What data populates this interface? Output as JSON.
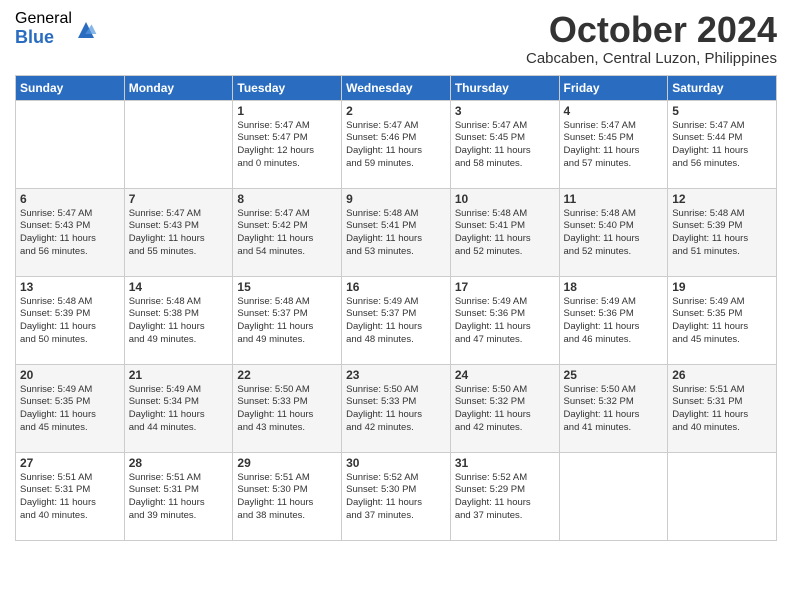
{
  "header": {
    "logo_general": "General",
    "logo_blue": "Blue",
    "month_title": "October 2024",
    "location": "Cabcaben, Central Luzon, Philippines"
  },
  "days_of_week": [
    "Sunday",
    "Monday",
    "Tuesday",
    "Wednesday",
    "Thursday",
    "Friday",
    "Saturday"
  ],
  "weeks": [
    [
      {
        "day": "",
        "content": ""
      },
      {
        "day": "",
        "content": ""
      },
      {
        "day": "1",
        "content": "Sunrise: 5:47 AM\nSunset: 5:47 PM\nDaylight: 12 hours\nand 0 minutes."
      },
      {
        "day": "2",
        "content": "Sunrise: 5:47 AM\nSunset: 5:46 PM\nDaylight: 11 hours\nand 59 minutes."
      },
      {
        "day": "3",
        "content": "Sunrise: 5:47 AM\nSunset: 5:45 PM\nDaylight: 11 hours\nand 58 minutes."
      },
      {
        "day": "4",
        "content": "Sunrise: 5:47 AM\nSunset: 5:45 PM\nDaylight: 11 hours\nand 57 minutes."
      },
      {
        "day": "5",
        "content": "Sunrise: 5:47 AM\nSunset: 5:44 PM\nDaylight: 11 hours\nand 56 minutes."
      }
    ],
    [
      {
        "day": "6",
        "content": "Sunrise: 5:47 AM\nSunset: 5:43 PM\nDaylight: 11 hours\nand 56 minutes."
      },
      {
        "day": "7",
        "content": "Sunrise: 5:47 AM\nSunset: 5:43 PM\nDaylight: 11 hours\nand 55 minutes."
      },
      {
        "day": "8",
        "content": "Sunrise: 5:47 AM\nSunset: 5:42 PM\nDaylight: 11 hours\nand 54 minutes."
      },
      {
        "day": "9",
        "content": "Sunrise: 5:48 AM\nSunset: 5:41 PM\nDaylight: 11 hours\nand 53 minutes."
      },
      {
        "day": "10",
        "content": "Sunrise: 5:48 AM\nSunset: 5:41 PM\nDaylight: 11 hours\nand 52 minutes."
      },
      {
        "day": "11",
        "content": "Sunrise: 5:48 AM\nSunset: 5:40 PM\nDaylight: 11 hours\nand 52 minutes."
      },
      {
        "day": "12",
        "content": "Sunrise: 5:48 AM\nSunset: 5:39 PM\nDaylight: 11 hours\nand 51 minutes."
      }
    ],
    [
      {
        "day": "13",
        "content": "Sunrise: 5:48 AM\nSunset: 5:39 PM\nDaylight: 11 hours\nand 50 minutes."
      },
      {
        "day": "14",
        "content": "Sunrise: 5:48 AM\nSunset: 5:38 PM\nDaylight: 11 hours\nand 49 minutes."
      },
      {
        "day": "15",
        "content": "Sunrise: 5:48 AM\nSunset: 5:37 PM\nDaylight: 11 hours\nand 49 minutes."
      },
      {
        "day": "16",
        "content": "Sunrise: 5:49 AM\nSunset: 5:37 PM\nDaylight: 11 hours\nand 48 minutes."
      },
      {
        "day": "17",
        "content": "Sunrise: 5:49 AM\nSunset: 5:36 PM\nDaylight: 11 hours\nand 47 minutes."
      },
      {
        "day": "18",
        "content": "Sunrise: 5:49 AM\nSunset: 5:36 PM\nDaylight: 11 hours\nand 46 minutes."
      },
      {
        "day": "19",
        "content": "Sunrise: 5:49 AM\nSunset: 5:35 PM\nDaylight: 11 hours\nand 45 minutes."
      }
    ],
    [
      {
        "day": "20",
        "content": "Sunrise: 5:49 AM\nSunset: 5:35 PM\nDaylight: 11 hours\nand 45 minutes."
      },
      {
        "day": "21",
        "content": "Sunrise: 5:49 AM\nSunset: 5:34 PM\nDaylight: 11 hours\nand 44 minutes."
      },
      {
        "day": "22",
        "content": "Sunrise: 5:50 AM\nSunset: 5:33 PM\nDaylight: 11 hours\nand 43 minutes."
      },
      {
        "day": "23",
        "content": "Sunrise: 5:50 AM\nSunset: 5:33 PM\nDaylight: 11 hours\nand 42 minutes."
      },
      {
        "day": "24",
        "content": "Sunrise: 5:50 AM\nSunset: 5:32 PM\nDaylight: 11 hours\nand 42 minutes."
      },
      {
        "day": "25",
        "content": "Sunrise: 5:50 AM\nSunset: 5:32 PM\nDaylight: 11 hours\nand 41 minutes."
      },
      {
        "day": "26",
        "content": "Sunrise: 5:51 AM\nSunset: 5:31 PM\nDaylight: 11 hours\nand 40 minutes."
      }
    ],
    [
      {
        "day": "27",
        "content": "Sunrise: 5:51 AM\nSunset: 5:31 PM\nDaylight: 11 hours\nand 40 minutes."
      },
      {
        "day": "28",
        "content": "Sunrise: 5:51 AM\nSunset: 5:31 PM\nDaylight: 11 hours\nand 39 minutes."
      },
      {
        "day": "29",
        "content": "Sunrise: 5:51 AM\nSunset: 5:30 PM\nDaylight: 11 hours\nand 38 minutes."
      },
      {
        "day": "30",
        "content": "Sunrise: 5:52 AM\nSunset: 5:30 PM\nDaylight: 11 hours\nand 37 minutes."
      },
      {
        "day": "31",
        "content": "Sunrise: 5:52 AM\nSunset: 5:29 PM\nDaylight: 11 hours\nand 37 minutes."
      },
      {
        "day": "",
        "content": ""
      },
      {
        "day": "",
        "content": ""
      }
    ]
  ]
}
